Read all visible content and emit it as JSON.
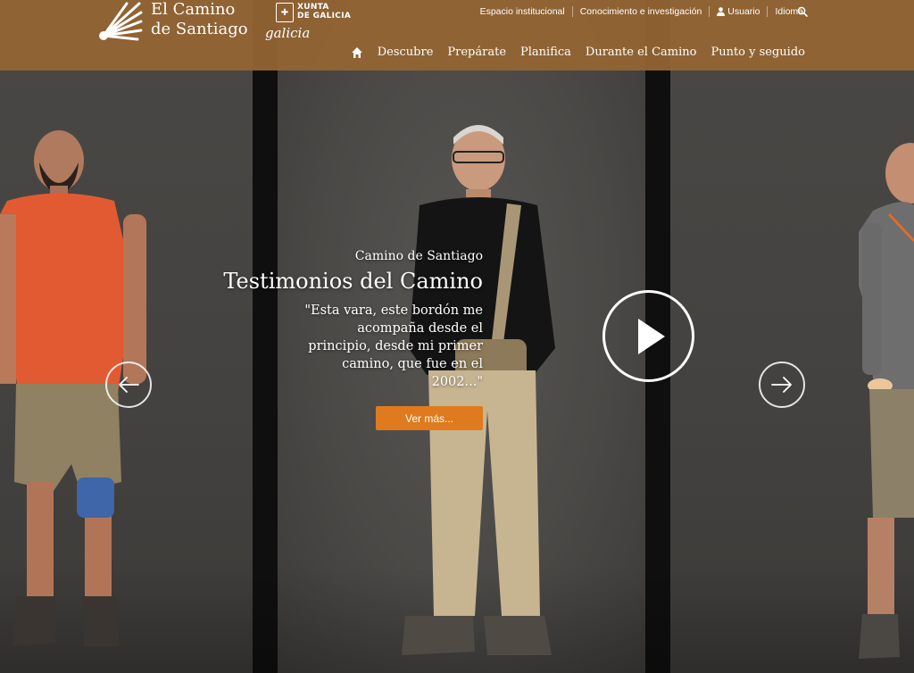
{
  "brand": {
    "logo_line1": "El Camino",
    "logo_line2": "de Santiago",
    "partner_line1": "XUNTA",
    "partner_line2": "DE GALICIA",
    "partner_sub": "galicia"
  },
  "top_nav": {
    "items": [
      "Espacio institucional",
      "Conocimiento e investigación",
      "Usuario",
      "Idioma"
    ],
    "search_icon": "search-icon",
    "user_icon": "user-icon"
  },
  "main_nav": {
    "home_icon": "home-icon",
    "items": [
      "Descubre",
      "Prepárate",
      "Planifica",
      "Durante el Camino",
      "Punto y seguido"
    ]
  },
  "slide": {
    "subtitle": "Camino de Santiago",
    "title": "Testimonios del Camino",
    "quote": "\"Esta vara, este bordón me acompaña desde el principio, desde mi primer camino, que fue en el 2002...\"",
    "cta_label": "Ver más..."
  },
  "controls": {
    "prev_icon": "arrow-left-icon",
    "next_icon": "arrow-right-icon",
    "play_icon": "play-icon"
  },
  "colors": {
    "header": "#956533",
    "cta": "#e07a1e",
    "background": "#4a4845"
  }
}
